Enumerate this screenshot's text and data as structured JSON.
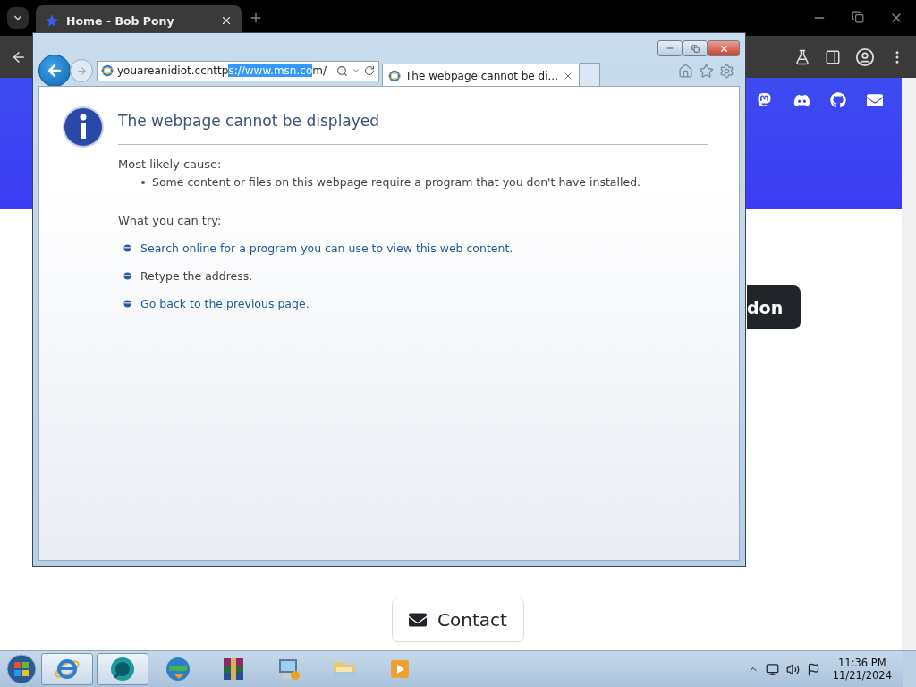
{
  "chrome": {
    "tabs": [
      {
        "title": "Home - Bob Pony",
        "selected": true
      }
    ],
    "page": {
      "partial_button": "don",
      "contact_button": "Contact"
    }
  },
  "ie": {
    "address": {
      "before": "youareanidiot.cchttp",
      "selected": "s://www.msn.co",
      "after": "m/"
    },
    "tabs": [
      {
        "title": "The webpage cannot be di...",
        "selected": true
      }
    ],
    "error": {
      "title": "The webpage cannot be displayed",
      "cause_label": "Most likely cause:",
      "causes": [
        "Some content or files on this webpage require a program that you don't have installed."
      ],
      "try_label": "What you can try:",
      "suggestions": [
        {
          "text": "Search online for a program you can use to view this web content.",
          "kind": "link"
        },
        {
          "text": "Retype the address.",
          "kind": "text"
        },
        {
          "text": "Go back to the previous page.",
          "kind": "link"
        }
      ]
    }
  },
  "taskbar": {
    "apps": [
      {
        "kind": "ie",
        "selected": true
      },
      {
        "kind": "orb",
        "selected": true
      },
      {
        "kind": "globe",
        "selected": false
      },
      {
        "kind": "archive",
        "selected": false
      },
      {
        "kind": "computer",
        "selected": false
      },
      {
        "kind": "folder",
        "selected": false
      },
      {
        "kind": "player",
        "selected": false
      }
    ],
    "clock": {
      "time": "11:36 PM",
      "date": "11/21/2024"
    }
  }
}
